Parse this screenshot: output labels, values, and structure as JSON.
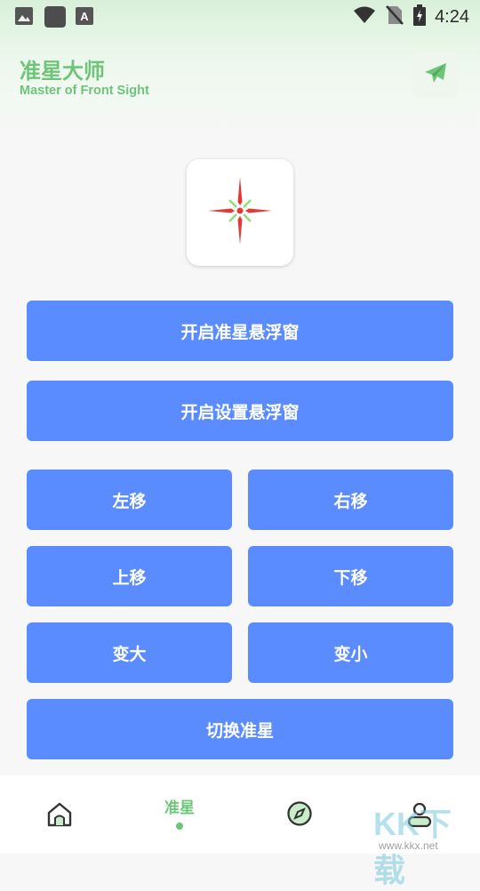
{
  "status_bar": {
    "time": "4:24",
    "left_icons": [
      "image-icon",
      "app-square-icon",
      "font-a-icon"
    ],
    "right_icons": [
      "wifi-icon",
      "no-sim-icon",
      "battery-charging-icon"
    ]
  },
  "header": {
    "title": "准星大师",
    "subtitle": "Master of Front Sight",
    "send_icon": "paper-plane-icon",
    "accent": "#6ec57a"
  },
  "crosshair_preview": {
    "icon": "crosshair-icon"
  },
  "buttons": {
    "open_crosshair_float": "开启准星悬浮窗",
    "open_settings_float": "开启设置悬浮窗",
    "move_left": "左移",
    "move_right": "右移",
    "move_up": "上移",
    "move_down": "下移",
    "bigger": "变大",
    "smaller": "变小",
    "switch_crosshair": "切换准星",
    "color": "#5b8cff"
  },
  "bottom_nav": {
    "items": [
      {
        "icon": "home-icon",
        "label": ""
      },
      {
        "icon": "",
        "label": "准星",
        "active": true
      },
      {
        "icon": "compass-icon",
        "label": ""
      },
      {
        "icon": "user-icon",
        "label": ""
      }
    ]
  },
  "watermark": {
    "text": "KK下载",
    "url": "www.kkx.net"
  }
}
